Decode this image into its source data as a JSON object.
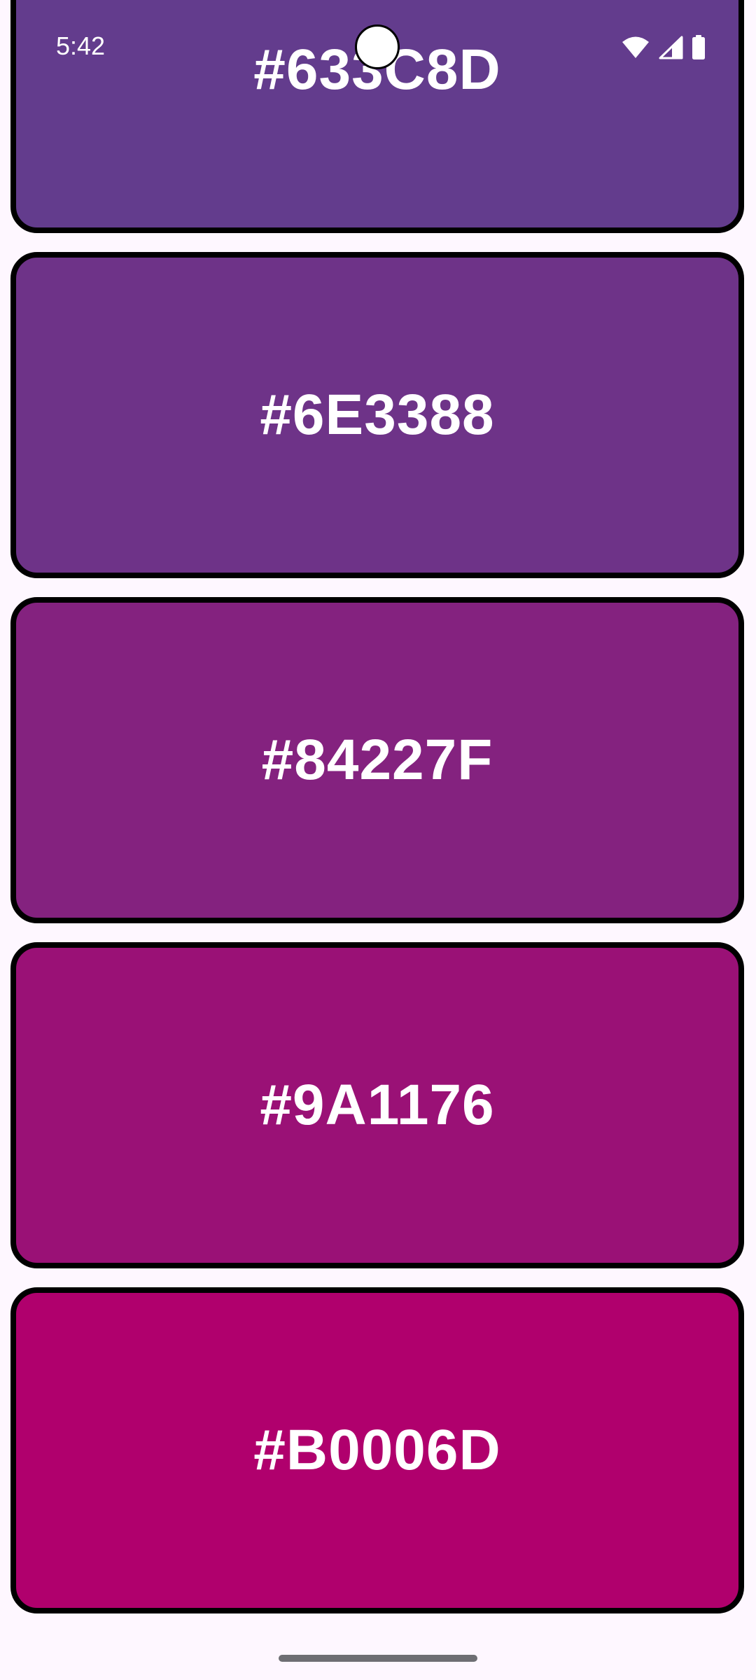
{
  "status_bar": {
    "time": "5:42",
    "icons": [
      "wifi-icon",
      "cellular-signal-icon",
      "battery-icon"
    ]
  },
  "swatches": [
    {
      "hex": "#633C8D",
      "color": "#633C8D"
    },
    {
      "hex": "#6E3388",
      "color": "#6E3388"
    },
    {
      "hex": "#84227F",
      "color": "#84227F"
    },
    {
      "hex": "#9A1176",
      "color": "#9A1176"
    },
    {
      "hex": "#B0006D",
      "color": "#B0006D"
    }
  ],
  "colors": {
    "background": "#FEF7FF",
    "border": "#000000",
    "label": "#FFFFFF"
  }
}
